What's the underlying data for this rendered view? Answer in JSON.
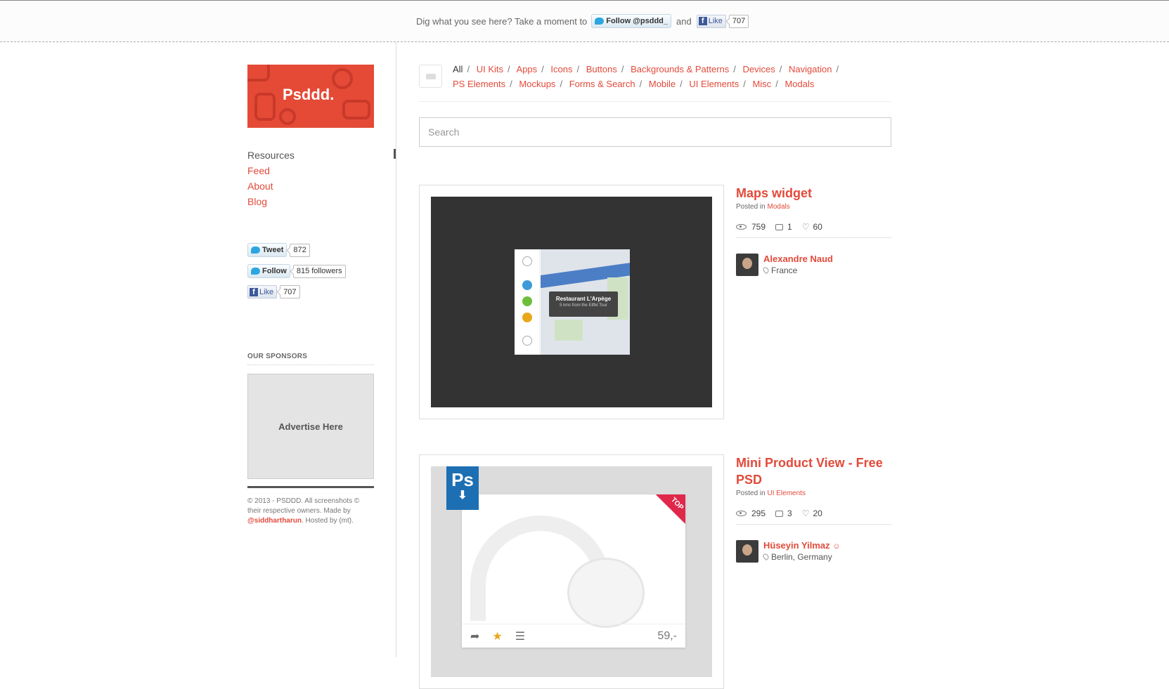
{
  "topbar": {
    "message": "Dig what you see here? Take a moment to",
    "follow_label": "Follow @psddd_",
    "and": "and",
    "like_label": "Like",
    "like_count": "707"
  },
  "sidebar": {
    "logo_text": "Psddd.",
    "nav": [
      "Resources",
      "Feed",
      "About",
      "Blog"
    ],
    "tweet_label": "Tweet",
    "tweet_count": "872",
    "follow_label": "Follow",
    "follow_count": "815 followers",
    "like_label": "Like",
    "like_count": "707",
    "sponsors_title": "OUR SPONSORS",
    "ad_text": "Advertise Here",
    "footer_text": "© 2013 - PSDDD. All screenshots © their respective owners. Made by",
    "footer_link": "@siddhartharun",
    "footer_suffix": ". Hosted by (mt)."
  },
  "categories": {
    "all": "All",
    "items": [
      "UI Kits",
      "Apps",
      "Icons",
      "Buttons",
      "Backgrounds & Patterns",
      "Devices",
      "Navigation",
      "PS Elements",
      "Mockups",
      "Forms & Search",
      "Mobile",
      "UI Elements",
      "Misc",
      "Modals"
    ]
  },
  "search": {
    "placeholder": "Search"
  },
  "posts": [
    {
      "title": "Maps widget",
      "posted_in": "Posted in",
      "category": "Modals",
      "views": "759",
      "comments": "1",
      "likes": "60",
      "author": "Alexandre Naud",
      "location": "France",
      "map_tooltip_title": "Restaurant L'Arpège",
      "map_tooltip_sub": "5 kms from the Eiffel Tour"
    },
    {
      "title": "Mini Product View - Free PSD",
      "posted_in": "Posted in",
      "category": "UI Elements",
      "views": "295",
      "comments": "3",
      "likes": "20",
      "author": "Hüseyin Yilmaz",
      "location": "Berlin, Germany",
      "ps_label": "Ps",
      "ribbon_label": "TOP",
      "price": "59,-"
    }
  ]
}
